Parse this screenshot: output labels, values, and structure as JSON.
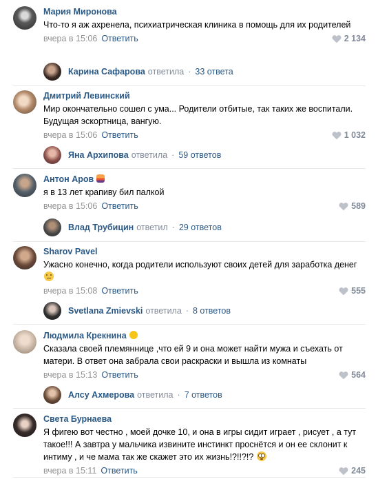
{
  "comments": [
    {
      "author": "Мария Миронова",
      "text": "Что-то я аж ахренела, психиатрическая клиника в помощь для их родителей",
      "time": "вчера в 15:06",
      "reply_label": "Ответить",
      "likes": "2 134",
      "thread": {
        "name": "Карина Сафарова",
        "verb": "ответила",
        "count": "33 ответа"
      }
    },
    {
      "author": "Дмитрий Левинский",
      "text": "Мир окончательно сошел с ума... Родители отбитые, так таких же воспитали. Будущая эскортница, вангую.",
      "time": "вчера в 15:06",
      "reply_label": "Ответить",
      "likes": "1 032",
      "thread": {
        "name": "Яна Архипова",
        "verb": "ответила",
        "count": "59 ответов"
      }
    },
    {
      "author": "Антон Аров",
      "author_emoji": "sunset-emoji",
      "text": "я в 13 лет крапиву бил палкой",
      "time": "вчера в 15:06",
      "reply_label": "Ответить",
      "likes": "589",
      "thread": {
        "name": "Влад Трубицин",
        "verb": "ответил",
        "count": "29 ответов"
      }
    },
    {
      "author": "Sharov Pavel",
      "text": "Ужасно конечно, когда родители используют своих детей для заработка денег",
      "text_emoji": "neutral-face-emoji",
      "time": "вчера в 15:08",
      "reply_label": "Ответить",
      "likes": "555",
      "thread": {
        "name": "Svetlana Zmievski",
        "verb": "ответила",
        "count": "8 ответов"
      }
    },
    {
      "author": "Людмила Крекнина",
      "author_emoji": "chick-emoji",
      "text": "Сказала своей племяннице ,что ей 9 и она может найти мужа и съехать от матери. В ответ она забрала свои раскраски и вышла из комнаты",
      "time": "вчера в 15:13",
      "reply_label": "Ответить",
      "likes": "564",
      "thread": {
        "name": "Алсу Ахмерова",
        "verb": "ответила",
        "count": "7 ответов"
      }
    },
    {
      "author": "Света Бурнаева",
      "text": "Я фигею вот честно , моей дочке 10, и она в игры сидит играет , рисует , а тут такое!!! А завтра у мальчика извините инстинкт проснётся и он ее склонит к интиму , и че мама так же скажет это их жизнь!?!!?!?",
      "text_emoji": "flushed-face-emoji",
      "time": "вчера в 15:11",
      "reply_label": "Ответить",
      "likes": "245"
    }
  ],
  "colors": {
    "link": "#2a5885",
    "meta": "#939393",
    "likes": "#828a99",
    "divider": "#e7e8ec"
  }
}
